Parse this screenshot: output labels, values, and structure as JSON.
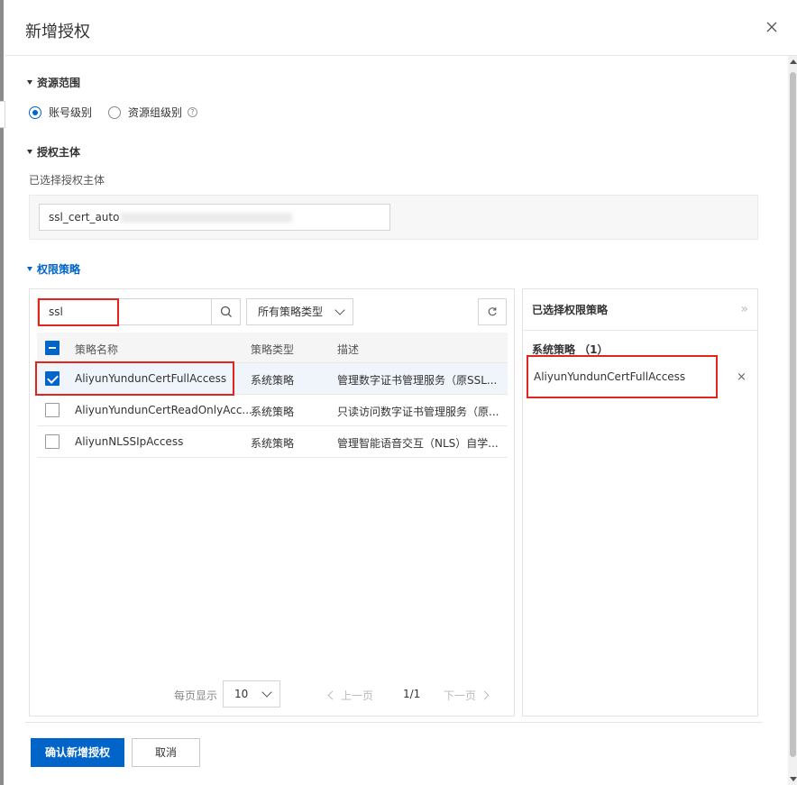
{
  "dialog": {
    "title": "新增授权",
    "close_icon": "close-icon"
  },
  "resource_scope": {
    "heading": "资源范围",
    "options": [
      {
        "label": "账号级别",
        "selected": true
      },
      {
        "label": "资源组级别",
        "selected": false
      }
    ],
    "help_glyph": "?"
  },
  "principal": {
    "heading": "授权主体",
    "subtitle": "已选择授权主体",
    "value": "ssl_cert_auto"
  },
  "policy": {
    "heading": "权限策略",
    "search_value": "ssl",
    "type_filter": "所有策略类型",
    "columns": [
      "策略名称",
      "策略类型",
      "描述"
    ],
    "rows": [
      {
        "name": "AliyunYundunCertFullAccess",
        "type": "系统策略",
        "desc": "管理数字证书管理服务（原SSL...",
        "checked": true
      },
      {
        "name": "AliyunYundunCertReadOnlyAcc...",
        "type": "系统策略",
        "desc": "只读访问数字证书管理服务（原...",
        "checked": false
      },
      {
        "name": "AliyunNLSSIpAccess",
        "type": "系统策略",
        "desc": "管理智能语音交互（NLS）自学...",
        "checked": false
      }
    ],
    "pager": {
      "per_page_label": "每页显示",
      "per_page": "10",
      "prev": "上一页",
      "page": "1/1",
      "next": "下一页"
    }
  },
  "selected_panel": {
    "title": "已选择权限策略",
    "collapse_glyph": "»",
    "group": "系统策略 （1）",
    "items": [
      "AliyunYundunCertFullAccess"
    ],
    "remove_glyph": "×"
  },
  "footer": {
    "confirm": "确认新增授权",
    "cancel": "取消"
  },
  "colors": {
    "primary": "#0064c8",
    "highlight": "#e1251b"
  }
}
